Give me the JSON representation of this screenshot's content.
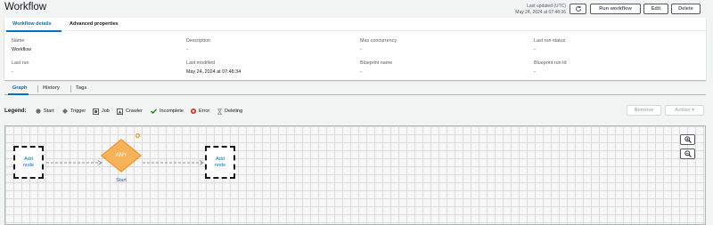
{
  "page": {
    "title": "Workflow"
  },
  "header": {
    "last_updated_label": "Last updated (UTC)",
    "last_updated_value": "May 24, 2024 at 07:48:36",
    "refresh_icon": "refresh-icon",
    "run_label": "Run workflow",
    "edit_label": "Edit",
    "delete_label": "Delete"
  },
  "details": {
    "tabs": [
      "Workflow details",
      "Advanced properties"
    ],
    "fields": [
      {
        "label": "Name",
        "value": "Workflow"
      },
      {
        "label": "Description",
        "value": "-"
      },
      {
        "label": "Max concurrency",
        "value": "-"
      },
      {
        "label": "Last run status",
        "value": "-"
      },
      {
        "label": "Last run",
        "value": "-"
      },
      {
        "label": "Last modified",
        "value": "May 24, 2024 at 07:48:34"
      },
      {
        "label": "Blueprint name",
        "value": "-"
      },
      {
        "label": "Blueprint run Id",
        "value": "-"
      }
    ]
  },
  "graph_tabs": [
    "Graph",
    "History",
    "Tags"
  ],
  "legend": {
    "label": "Legend:",
    "items": [
      {
        "name": "Start",
        "icon": "start-dot-icon",
        "color": "#687078"
      },
      {
        "name": "Trigger",
        "icon": "trigger-diamond-icon",
        "color": "#687078"
      },
      {
        "name": "Job",
        "icon": "job-icon",
        "color": "#545b64"
      },
      {
        "name": "Crawler",
        "icon": "crawler-icon",
        "color": "#545b64"
      },
      {
        "name": "Incomplete",
        "icon": "check-icon",
        "color": "#1d8102"
      },
      {
        "name": "Error",
        "icon": "error-icon",
        "color": "#d13212"
      },
      {
        "name": "Deleting",
        "icon": "hourglass-icon",
        "color": "#879596"
      }
    ],
    "remove_label": "Remove",
    "action_label": "Action ▾"
  },
  "graph": {
    "left_node_label": [
      "Add",
      "node"
    ],
    "trigger_label": "ANY",
    "trigger_caption": "Start",
    "right_node_label": [
      "Add",
      "node"
    ],
    "colors": {
      "trigger_fill": "#f8b35a",
      "trigger_stroke": "#f19d38",
      "link": "#0073bb"
    }
  }
}
